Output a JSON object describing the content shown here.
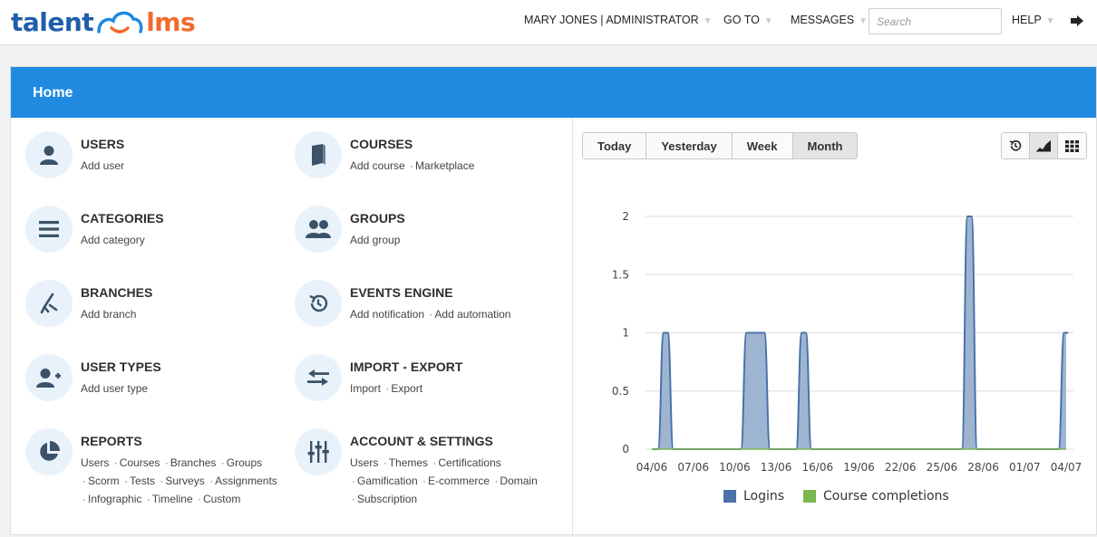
{
  "brand": {
    "word1": "talent",
    "word2": "lms",
    "colors": {
      "talent": "#1f5ea8",
      "lms": "#f26a2b"
    }
  },
  "topbar": {
    "user": "MARY JONES | ADMINISTRATOR",
    "goto": "GO TO",
    "messages": "MESSAGES",
    "search_placeholder": "Search",
    "help": "HELP",
    "logout_icon": "sign-out-icon"
  },
  "page": {
    "title": "Home",
    "header_color": "#1f8ae0"
  },
  "items": [
    {
      "title": "USERS",
      "icon": "user-icon",
      "links": [
        "Add user"
      ]
    },
    {
      "title": "COURSES",
      "icon": "book-icon",
      "links": [
        "Add course",
        "Marketplace"
      ]
    },
    {
      "title": "CATEGORIES",
      "icon": "list-icon",
      "links": [
        "Add category"
      ]
    },
    {
      "title": "GROUPS",
      "icon": "group-icon",
      "links": [
        "Add group"
      ]
    },
    {
      "title": "BRANCHES",
      "icon": "branch-icon",
      "links": [
        "Add branch"
      ]
    },
    {
      "title": "EVENTS ENGINE",
      "icon": "history-icon",
      "links": [
        "Add notification",
        "Add automation"
      ]
    },
    {
      "title": "USER TYPES",
      "icon": "user-plus-icon",
      "links": [
        "Add user type"
      ]
    },
    {
      "title": "IMPORT - EXPORT",
      "icon": "swap-icon",
      "links": [
        "Import",
        "Export"
      ]
    },
    {
      "title": "REPORTS",
      "icon": "pie-chart-icon",
      "links": [
        "Users",
        "Courses",
        "Branches",
        "Groups",
        "Scorm",
        "Tests",
        "Surveys",
        "Assignments",
        "Infographic",
        "Timeline",
        "Custom"
      ]
    },
    {
      "title": "ACCOUNT & SETTINGS",
      "icon": "sliders-icon",
      "links": [
        "Users",
        "Themes",
        "Certifications",
        "Gamification",
        "E-commerce",
        "Domain",
        "Subscription"
      ]
    }
  ],
  "period_tabs": [
    {
      "label": "Today",
      "active": false
    },
    {
      "label": "Yesterday",
      "active": false
    },
    {
      "label": "Week",
      "active": false
    },
    {
      "label": "Month",
      "active": true
    }
  ],
  "view_icons": [
    {
      "name": "history-view-icon",
      "active": false
    },
    {
      "name": "area-chart-view-icon",
      "active": true
    },
    {
      "name": "grid-view-icon",
      "active": false
    }
  ],
  "chart_data": {
    "type": "area",
    "x": [
      "04/06",
      "05/06",
      "06/06",
      "07/06",
      "08/06",
      "09/06",
      "10/06",
      "11/06",
      "12/06",
      "13/06",
      "14/06",
      "15/06",
      "16/06",
      "17/06",
      "18/06",
      "19/06",
      "20/06",
      "21/06",
      "22/06",
      "23/06",
      "24/06",
      "25/06",
      "26/06",
      "27/06",
      "28/06",
      "29/06",
      "30/06",
      "01/07",
      "02/07",
      "03/07",
      "04/07"
    ],
    "x_tick_labels": [
      "04/06",
      "07/06",
      "10/06",
      "13/06",
      "16/06",
      "19/06",
      "22/06",
      "25/06",
      "28/06",
      "01/07",
      "04/07"
    ],
    "series": [
      {
        "name": "Logins",
        "color": "#4a72a8",
        "fill": "#9eb5d2",
        "values": [
          0,
          1,
          0,
          0,
          0,
          0,
          0,
          1,
          1,
          0,
          0,
          1,
          0,
          0,
          0,
          0,
          0,
          0,
          0,
          0,
          0,
          0,
          0,
          2,
          0,
          0,
          0,
          0,
          0,
          0,
          1
        ]
      },
      {
        "name": "Course completions",
        "color": "#7cb851",
        "values": [
          0,
          0,
          0,
          0,
          0,
          0,
          0,
          0,
          0,
          0,
          0,
          0,
          0,
          0,
          0,
          0,
          0,
          0,
          0,
          0,
          0,
          0,
          0,
          0,
          0,
          0,
          0,
          0,
          0,
          0,
          0
        ]
      }
    ],
    "y_ticks": [
      "0",
      "0.5",
      "1",
      "1.5",
      "2"
    ],
    "ylim": [
      0,
      2
    ],
    "grid": true,
    "legend": "bottom"
  }
}
